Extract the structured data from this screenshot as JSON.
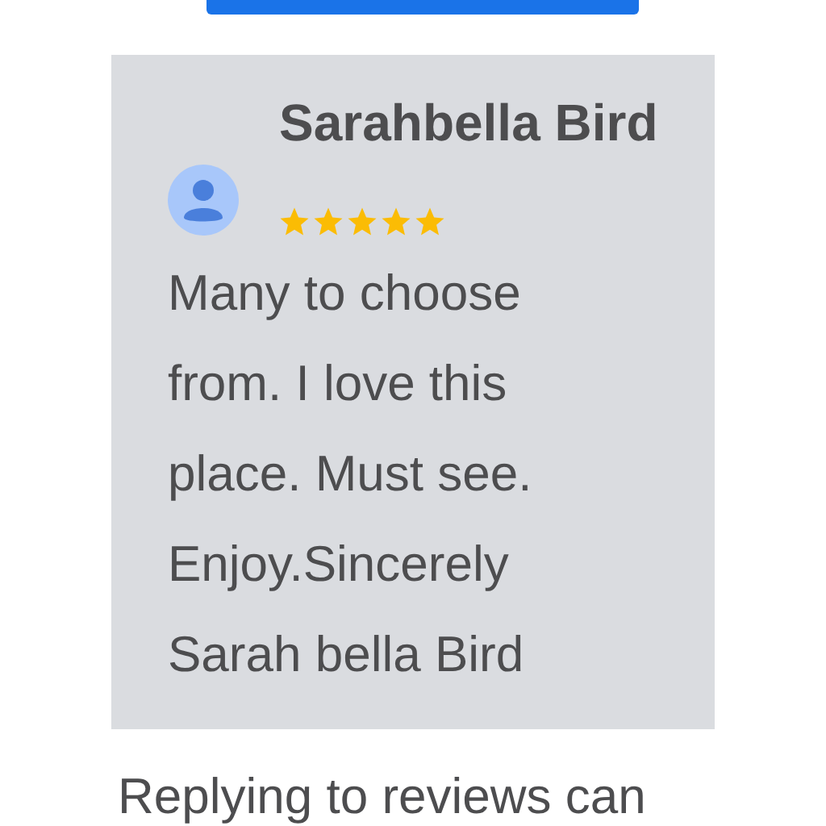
{
  "review": {
    "author": "Sarahbella Bird",
    "stars": 5,
    "text": "Many to choose from. I love this place. Must see. Enjoy.Sincerely Sarah bella Bird"
  },
  "footer_text": "Replying to reviews can"
}
